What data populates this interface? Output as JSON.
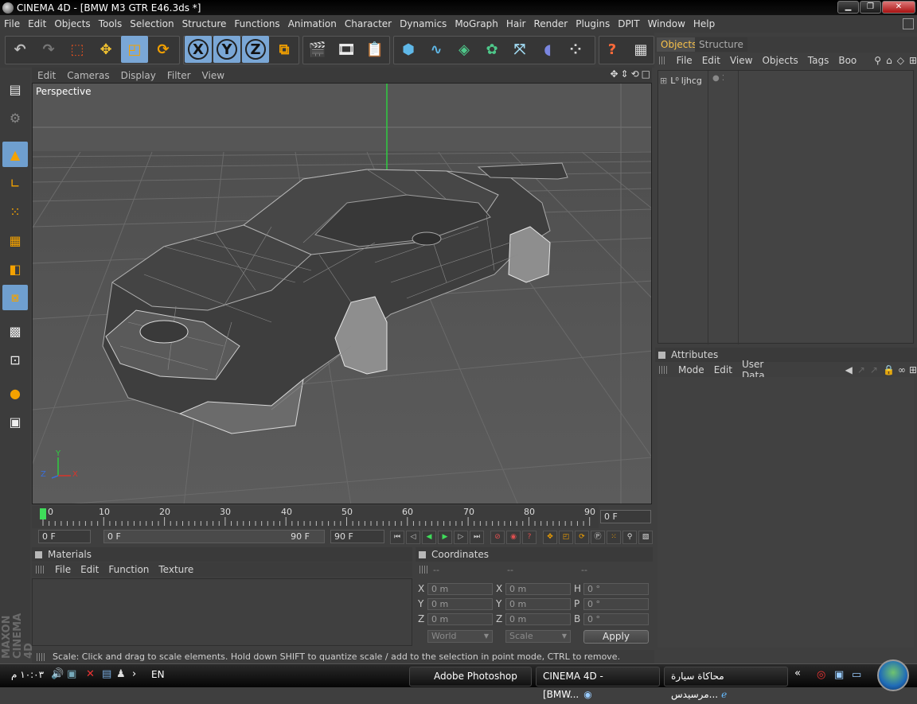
{
  "window": {
    "app": "CINEMA 4D",
    "title": "CINEMA 4D - [BMW M3 GTR E46.3ds *]"
  },
  "menu": [
    "File",
    "Edit",
    "Objects",
    "Tools",
    "Selection",
    "Structure",
    "Functions",
    "Animation",
    "Character",
    "Dynamics",
    "MoGraph",
    "Hair",
    "Render",
    "Plugins",
    "DPIT",
    "Window",
    "Help"
  ],
  "toolbar": {
    "axis_x": "X",
    "axis_y": "Y",
    "axis_z": "Z",
    "help": "?"
  },
  "viewport": {
    "menu": [
      "Edit",
      "Cameras",
      "Display",
      "Filter",
      "View"
    ],
    "label": "Perspective",
    "axis_x": "X",
    "axis_y": "Y",
    "axis_z": "Z"
  },
  "timeline": {
    "ticks": [
      "0",
      "10",
      "20",
      "30",
      "40",
      "50",
      "60",
      "70",
      "80",
      "90"
    ],
    "current_frame": "0 F",
    "start_field": "0 F",
    "range_start": "0 F",
    "range_end": "90 F",
    "end_field": "90 F"
  },
  "materials": {
    "title": "Materials",
    "menu": [
      "File",
      "Edit",
      "Function",
      "Texture"
    ]
  },
  "coordinates": {
    "title": "Coordinates",
    "col_headers": [
      "--",
      "--",
      "--"
    ],
    "position": {
      "x_label": "X",
      "y_label": "Y",
      "z_label": "Z",
      "x": "0 m",
      "y": "0 m",
      "z": "0 m"
    },
    "size": {
      "x_label": "X",
      "y_label": "Y",
      "z_label": "Z",
      "x": "0 m",
      "y": "0 m",
      "z": "0 m"
    },
    "rotation": {
      "h_label": "H",
      "p_label": "P",
      "b_label": "B",
      "h": "0 °",
      "p": "0 °",
      "b": "0 °"
    },
    "mode_dropdown": "World",
    "scale_dropdown": "Scale",
    "apply": "Apply"
  },
  "objects": {
    "tabs": [
      "Objects",
      "Structure"
    ],
    "menu": [
      "File",
      "Edit",
      "View",
      "Objects",
      "Tags",
      "Boo"
    ],
    "items": [
      {
        "name": "ljhcg"
      }
    ]
  },
  "attributes": {
    "title": "Attributes",
    "menu": [
      "Mode",
      "Edit",
      "User Data"
    ]
  },
  "status": "Scale: Click and drag to scale elements. Hold down SHIFT to quantize scale / add to the selection in point mode, CTRL to remove.",
  "sidebar_brand": "MAXON CINEMA 4D",
  "taskbar": {
    "clock": "١٠:٠٣ م",
    "language": "EN",
    "tasks": [
      "Adobe Photoshop",
      "CINEMA 4D - [BMW...",
      "محاكاة سيارة مرسيدس..."
    ],
    "chevron": "«"
  },
  "colors": {
    "accent_tab": "#f8c14a",
    "active_tool": "#7aa7d6",
    "y_axis": "#2ecc40",
    "x_axis": "#d9342b",
    "z_axis": "#3a6fd8"
  }
}
